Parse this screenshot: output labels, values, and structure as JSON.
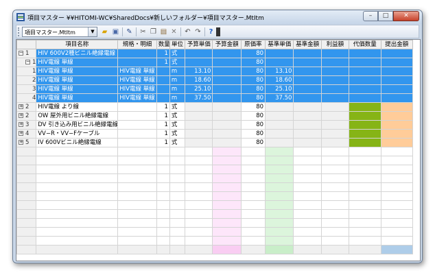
{
  "window": {
    "title": "項目マスター ¥¥HITOMI-WC¥SharedDocs¥新しいフォルダー¥項目マスター.MtItm",
    "buttons": {
      "minimize": "–",
      "maximize": "□",
      "close": "✕"
    }
  },
  "toolbar": {
    "combo_value": "項目マスター.MtItm",
    "icons": [
      "open-folder-icon",
      "save-icon",
      "edit-pen-icon",
      "cut-icon",
      "copy-icon",
      "paste-icon",
      "delete-icon",
      "undo-icon",
      "redo-icon",
      "help-icon"
    ]
  },
  "grid": {
    "columns": [
      "項目名称",
      "規格・明細",
      "数量",
      "単位",
      "予算単価",
      "予算金額",
      "原価率",
      "基準単価",
      "基準金額",
      "利益額",
      "代価数量",
      "提出金額"
    ],
    "rows": [
      {
        "level": 0,
        "expand": "−",
        "no": "1",
        "name": "HIV  600V2種ビニル絶縁電線",
        "spec": "",
        "qty": "1",
        "unit": "式",
        "yosan_tanka": "",
        "yosan_kingaku": "",
        "genka": "80",
        "kijun_tanka": "",
        "kijun_kingaku": ""
      },
      {
        "level": 1,
        "expand": "−",
        "no": "1",
        "name": "HIV電線  単線",
        "spec": "",
        "qty": "1",
        "unit": "式",
        "yosan_tanka": "",
        "yosan_kingaku": "",
        "genka": "80",
        "kijun_tanka": "",
        "kijun_kingaku": ""
      },
      {
        "level": 2,
        "expand": "",
        "no": "1",
        "name": "HIV電線  単線",
        "spec": "HIV電線  単線",
        "qty": "",
        "unit": "m",
        "yosan_tanka": "13.10",
        "yosan_kingaku": "",
        "genka": "80",
        "kijun_tanka": "13.10",
        "kijun_kingaku": ""
      },
      {
        "level": 2,
        "expand": "",
        "no": "2",
        "name": "HIV電線  単線",
        "spec": "HIV電線  単線",
        "qty": "",
        "unit": "m",
        "yosan_tanka": "18.60",
        "yosan_kingaku": "",
        "genka": "80",
        "kijun_tanka": "18.60",
        "kijun_kingaku": ""
      },
      {
        "level": 2,
        "expand": "",
        "no": "3",
        "name": "HIV電線  単線",
        "spec": "HIV電線  単線",
        "qty": "",
        "unit": "m",
        "yosan_tanka": "25.10",
        "yosan_kingaku": "",
        "genka": "80",
        "kijun_tanka": "25.10",
        "kijun_kingaku": ""
      },
      {
        "level": 2,
        "expand": "",
        "no": "4",
        "name": "HIV電線  単線",
        "spec": "HIV電線  単線",
        "qty": "",
        "unit": "m",
        "yosan_tanka": "37.50",
        "yosan_kingaku": "",
        "genka": "80",
        "kijun_tanka": "37.50",
        "kijun_kingaku": ""
      },
      {
        "level": 0,
        "expand": "+",
        "no": "2",
        "name": "HIV電線  より線",
        "spec": "",
        "qty": "1",
        "unit": "式",
        "yosan_tanka": "",
        "yosan_kingaku": "",
        "genka": "80",
        "kijun_tanka": "",
        "kijun_kingaku": ""
      },
      {
        "level": 0,
        "expand": "+",
        "no": "2",
        "name": "OW  屋外用ビニル絶縁電線",
        "spec": "",
        "qty": "1",
        "unit": "式",
        "yosan_tanka": "",
        "yosan_kingaku": "",
        "genka": "80",
        "kijun_tanka": "",
        "kijun_kingaku": ""
      },
      {
        "level": 0,
        "expand": "+",
        "no": "3",
        "name": "DV  引き込み用ビニル絶縁電線",
        "spec": "",
        "qty": "1",
        "unit": "式",
        "yosan_tanka": "",
        "yosan_kingaku": "",
        "genka": "80",
        "kijun_tanka": "",
        "kijun_kingaku": ""
      },
      {
        "level": 0,
        "expand": "+",
        "no": "4",
        "name": "VV−R・VV−Fケーブル",
        "spec": "",
        "qty": "1",
        "unit": "式",
        "yosan_tanka": "",
        "yosan_kingaku": "",
        "genka": "80",
        "kijun_tanka": "",
        "kijun_kingaku": ""
      },
      {
        "level": 0,
        "expand": "+",
        "no": "5",
        "name": "IV  600Vビニル絶縁電線",
        "spec": "",
        "qty": "1",
        "unit": "式",
        "yosan_tanka": "",
        "yosan_kingaku": "",
        "genka": "80",
        "kijun_tanka": "",
        "kijun_kingaku": ""
      }
    ]
  },
  "colors": {
    "selection": "#3296ee",
    "daika_header": "#8db32a",
    "daika_cell": "#86b416",
    "teishutsu_cell": "#ffcc99",
    "yosan_kingaku_col": "#fde6fa",
    "kijun_tanka_col": "#dcf5dc"
  }
}
